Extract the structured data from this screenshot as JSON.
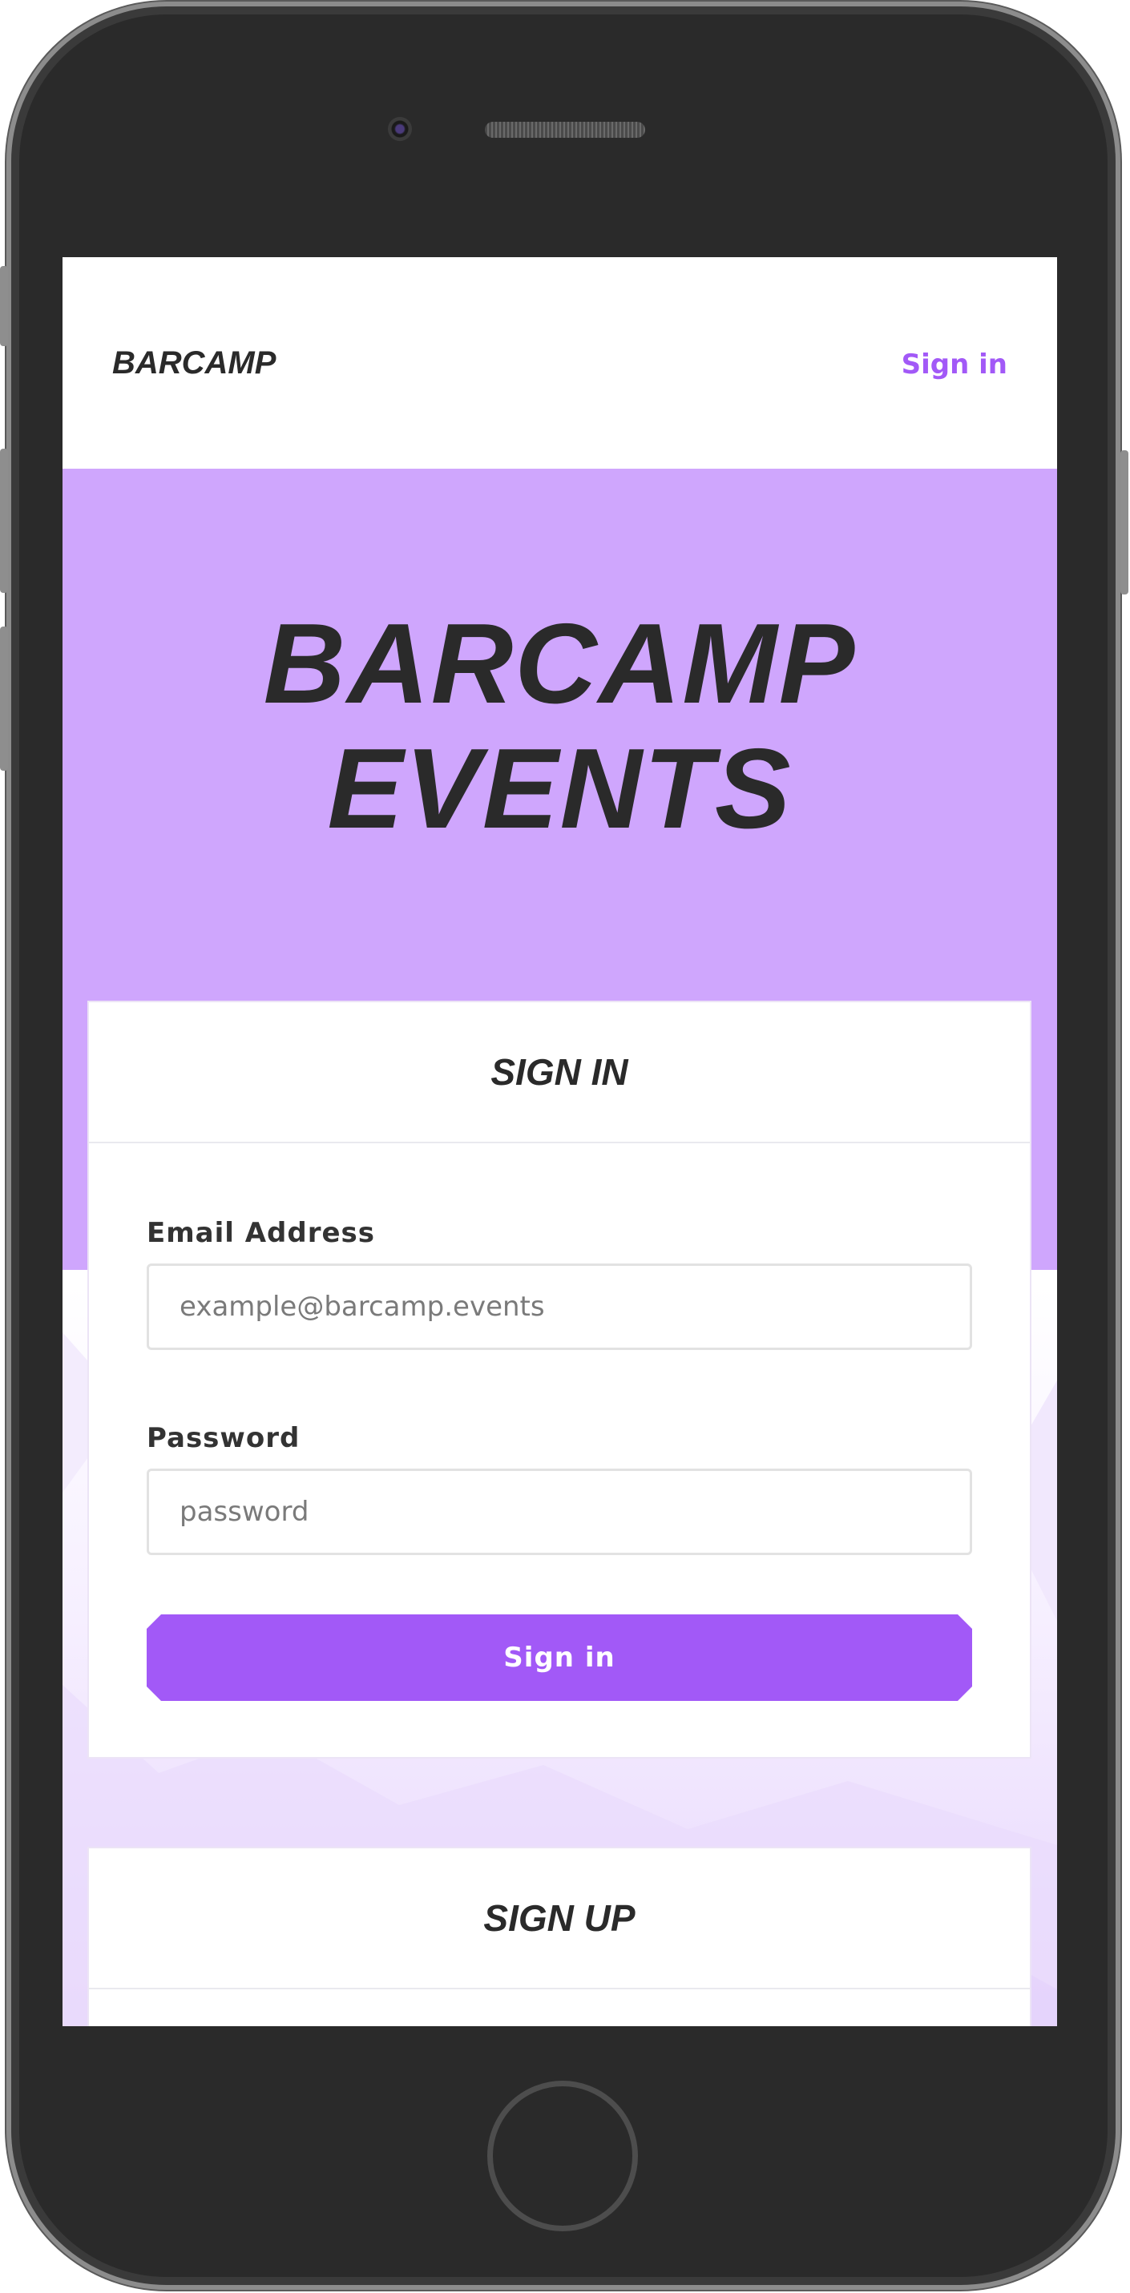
{
  "header": {
    "logo": "BARCAMP",
    "nav_signin": "Sign in"
  },
  "hero": {
    "title_line1": "BARCAMP",
    "title_line2": "EVENTS"
  },
  "signin_card": {
    "title": "SIGN IN",
    "email_label": "Email Address",
    "email_placeholder": "example@barcamp.events",
    "password_label": "Password",
    "password_placeholder": "password",
    "submit_label": "Sign in"
  },
  "signup_card": {
    "title": "SIGN UP"
  },
  "colors": {
    "accent": "#a259f7",
    "hero_bg": "#cfa6fd",
    "text_dark": "#2a2a2a"
  }
}
